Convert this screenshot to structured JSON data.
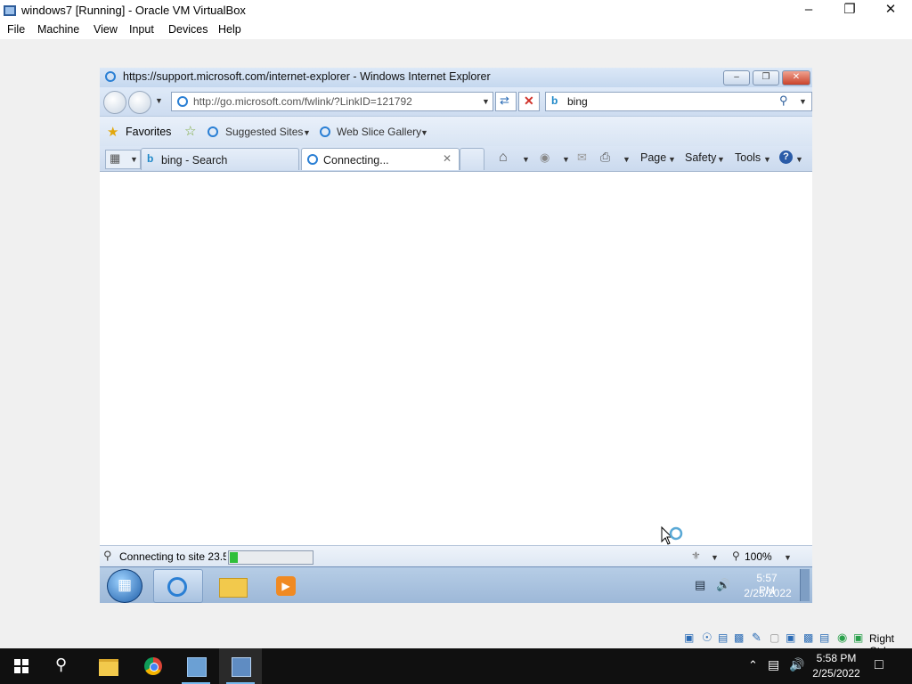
{
  "host": {
    "title": "windows7 [Running] - Oracle VM VirtualBox",
    "menu": [
      "File",
      "Machine",
      "View",
      "Input",
      "Devices",
      "Help"
    ],
    "right_ctrl": "Right Ctrl"
  },
  "ie": {
    "title": "https://support.microsoft.com/internet-explorer - Windows Internet Explorer",
    "address": "http://go.microsoft.com/fwlink/?LinkID=121792",
    "search_text": "bing",
    "favorites_label": "Favorites",
    "suggested_sites": "Suggested Sites",
    "web_slice_gallery": "Web Slice Gallery",
    "tabs": [
      {
        "label": "bing - Search"
      },
      {
        "label": "Connecting..."
      }
    ],
    "toolbar": {
      "page": "Page",
      "safety": "Safety",
      "tools": "Tools"
    },
    "status_text": "Connecting to site 23.5",
    "progress": 0.1,
    "zoom": "100%"
  },
  "guest_taskbar": {
    "time": "5:57 PM",
    "date": "2/25/2022"
  },
  "win10_taskbar": {
    "time": "5:58 PM",
    "date": "2/25/2022"
  }
}
